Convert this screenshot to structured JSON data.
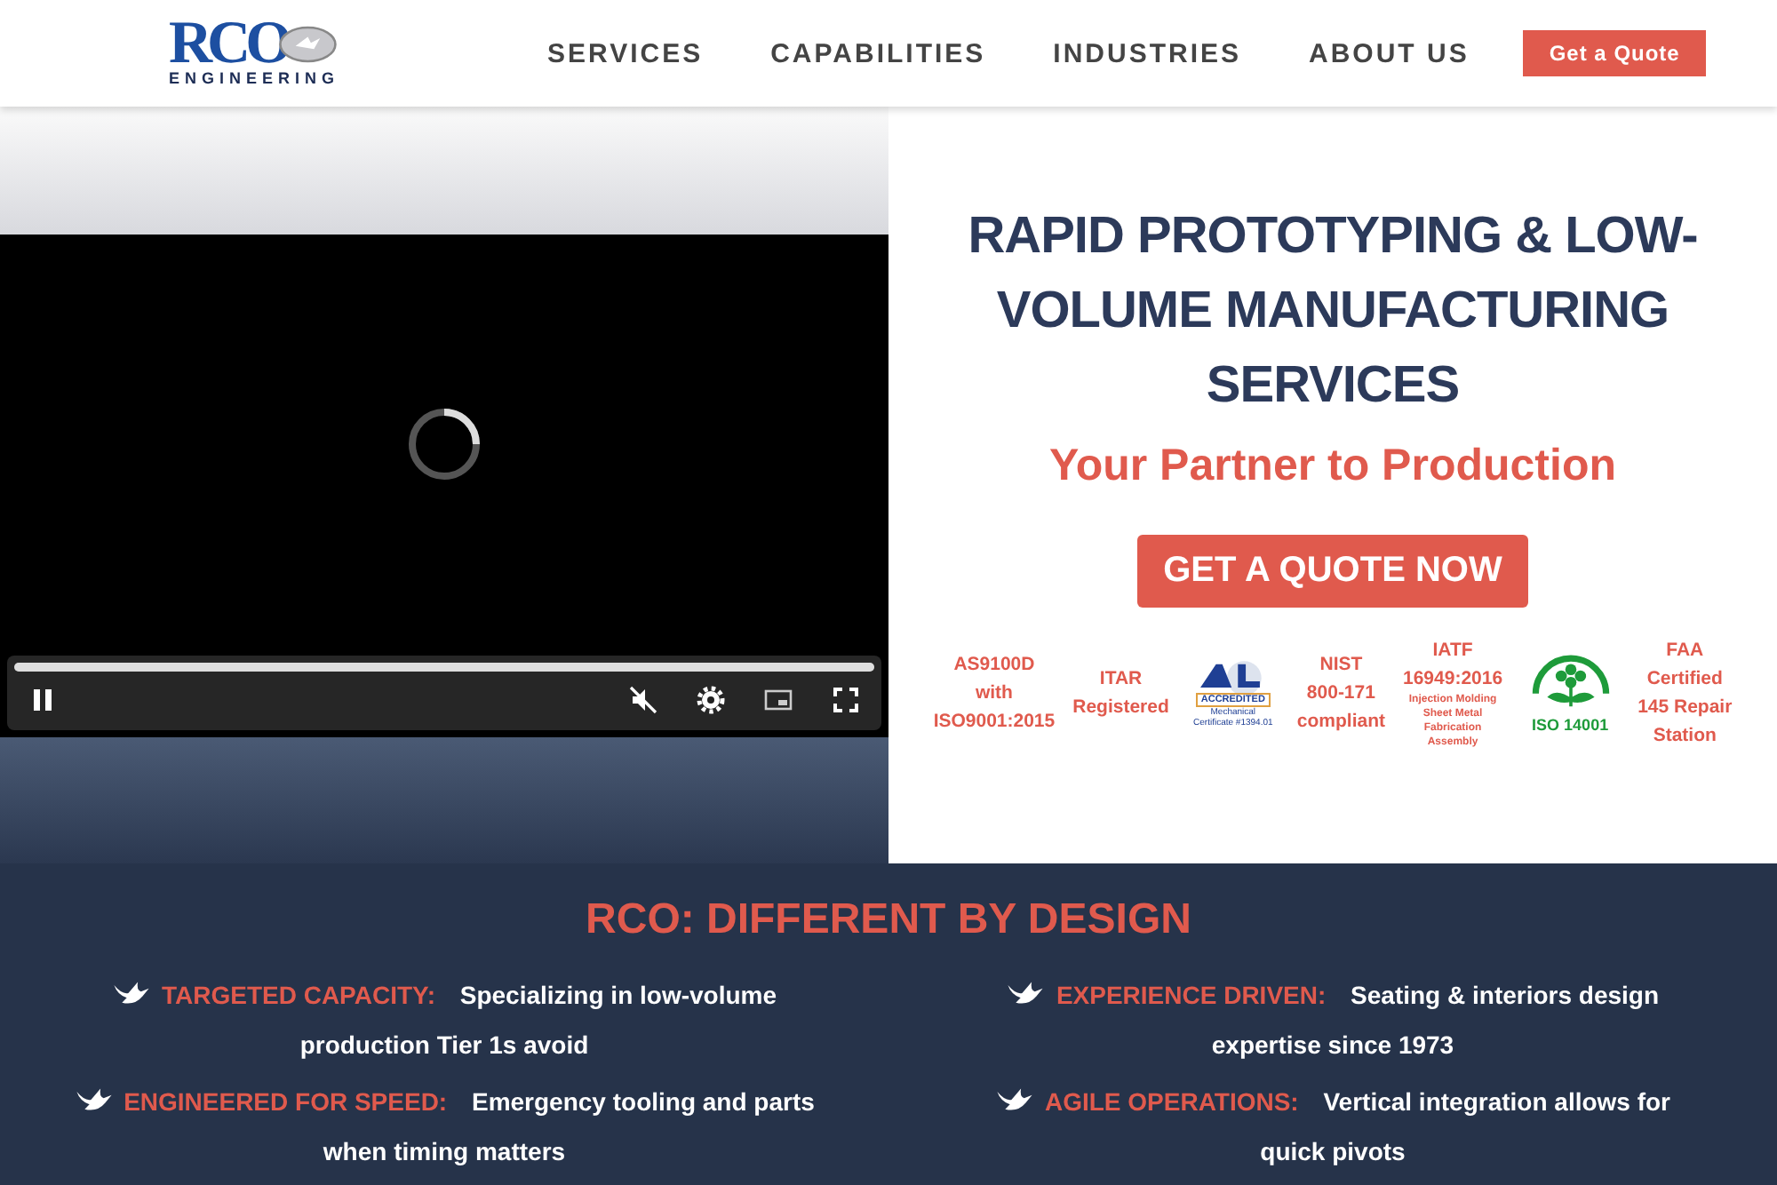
{
  "header": {
    "logo": {
      "mark": "RCO",
      "sub": "ENGINEERING"
    },
    "nav": [
      {
        "label": "SERVICES"
      },
      {
        "label": "CAPABILITIES"
      },
      {
        "label": "INDUSTRIES"
      },
      {
        "label": "ABOUT US"
      }
    ],
    "cta": "Get a Quote"
  },
  "video": {
    "playing": true,
    "muted": true,
    "progress": {
      "level": 1
    }
  },
  "hero": {
    "title": "RAPID PROTOTYPING & LOW-VOLUME MANUFACTURING SERVICES",
    "subtitle": "Your Partner to Production",
    "button": "GET A QUOTE NOW",
    "certifications": [
      {
        "kind": "text",
        "lines": [
          "AS9100D",
          "with",
          "ISO9001:2015"
        ]
      },
      {
        "kind": "text",
        "lines": [
          "ITAR",
          "Registered"
        ]
      },
      {
        "kind": "a2la",
        "lines": [
          "ACCREDITED",
          "Mechanical",
          "Certificate #1394.01"
        ]
      },
      {
        "kind": "text",
        "lines": [
          "NIST",
          "800-171",
          "compliant"
        ]
      },
      {
        "kind": "iatf",
        "lines": [
          "IATF",
          "16949:2016"
        ],
        "notes": [
          "Injection Molding",
          "Sheet Metal",
          "Fabrication",
          "Assembly"
        ]
      },
      {
        "kind": "iso",
        "lines": [
          "ISO 14001"
        ]
      },
      {
        "kind": "text",
        "lines": [
          "FAA",
          "Certified",
          "145 Repair",
          "Station"
        ]
      }
    ]
  },
  "features": {
    "title": "RCO: DIFFERENT BY DESIGN",
    "columns": [
      [
        {
          "label": "TARGETED CAPACITY:",
          "text": "Specializing in low-volume production Tier 1s avoid"
        },
        {
          "label": "ENGINEERED FOR SPEED:",
          "text": "Emergency tooling and parts when timing matters"
        }
      ],
      [
        {
          "label": "EXPERIENCE DRIVEN:",
          "text": "Seating & interiors design expertise since 1973"
        },
        {
          "label": "AGILE OPERATIONS:",
          "text": "Vertical integration allows for quick pivots"
        }
      ]
    ]
  }
}
